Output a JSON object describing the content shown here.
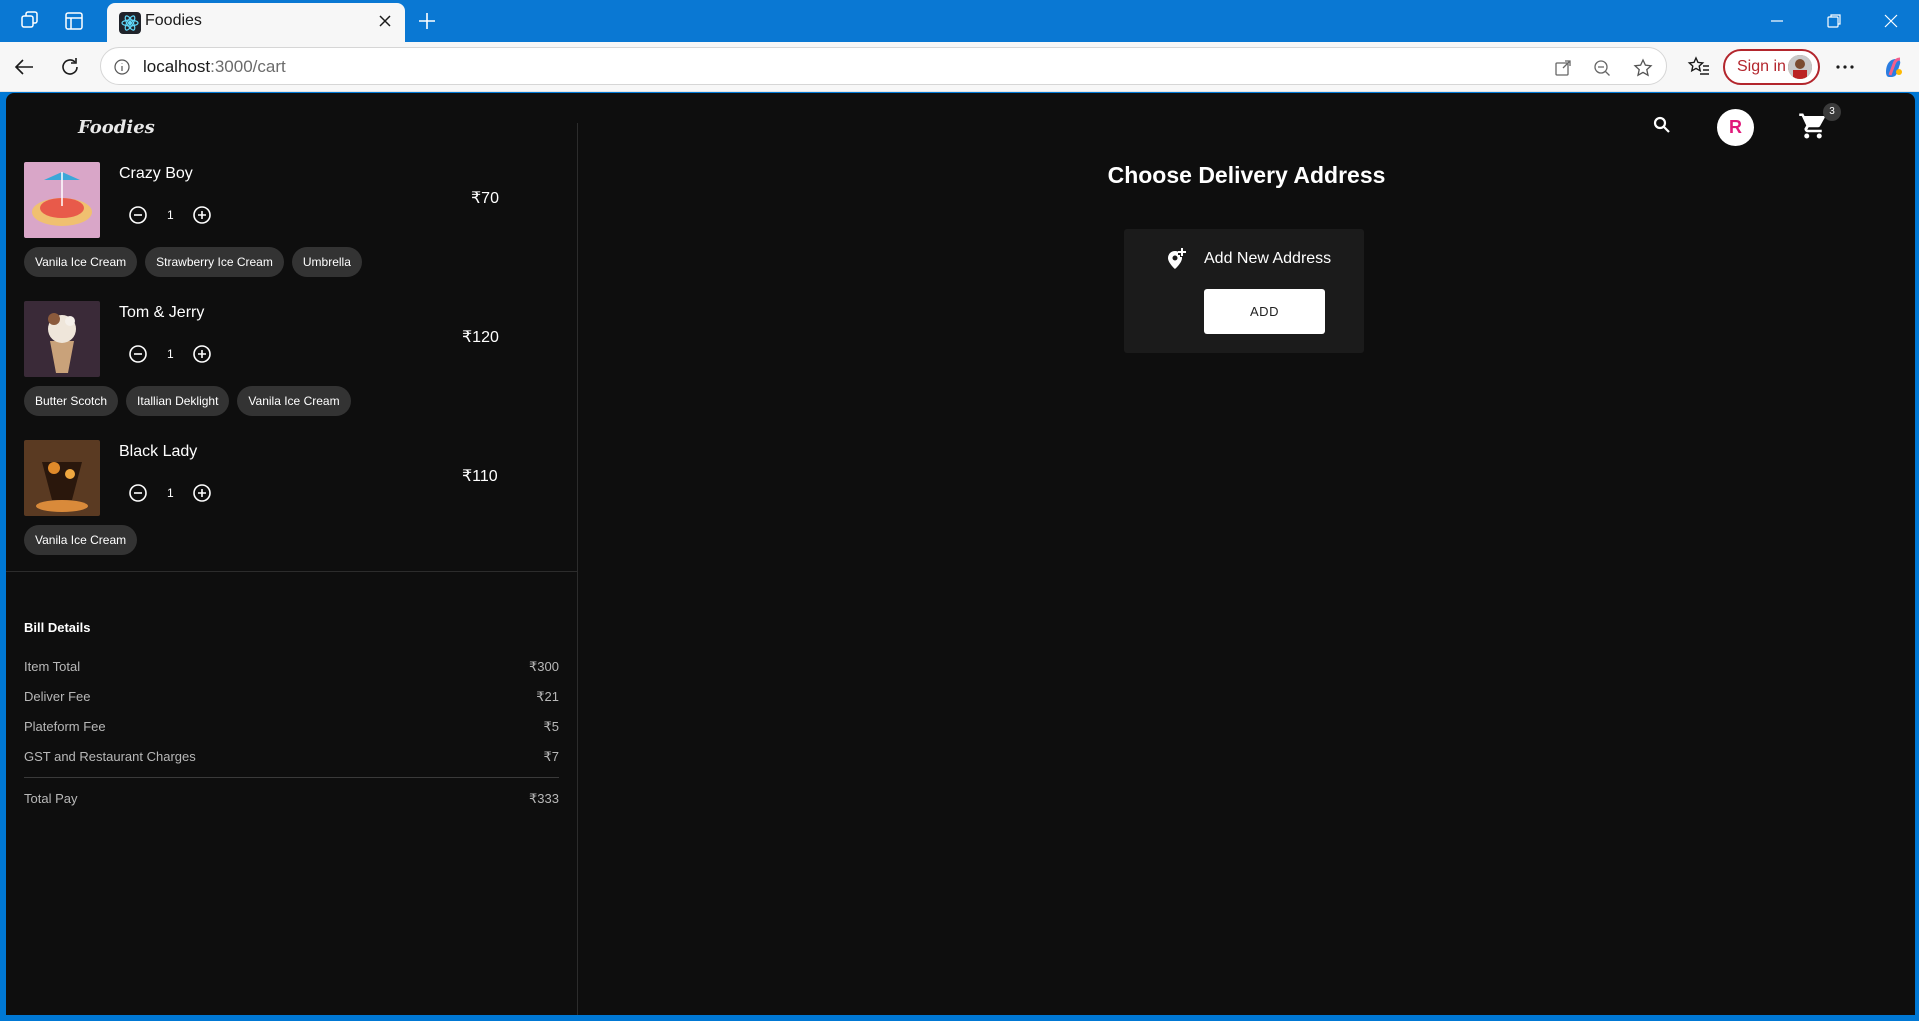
{
  "browser": {
    "tab_title": "Foodies",
    "url_host": "localhost",
    "url_path": ":3000/cart",
    "sign_in_label": "Sign in"
  },
  "header": {
    "brand": "Foodies",
    "avatar_letter": "R",
    "cart_count": "3"
  },
  "cart": {
    "items": [
      {
        "name": "Crazy Boy",
        "qty": "1",
        "price": "₹70",
        "addons": [
          "Vanila Ice Cream",
          "Strawberry Ice Cream",
          "Umbrella"
        ]
      },
      {
        "name": "Tom & Jerry",
        "qty": "1",
        "price": "₹120",
        "addons": [
          "Butter Scotch",
          "Itallian Deklight",
          "Vanila Ice Cream"
        ]
      },
      {
        "name": "Black Lady",
        "qty": "1",
        "price": "₹110",
        "addons": [
          "Vanila Ice Cream"
        ]
      }
    ]
  },
  "bill": {
    "title": "Bill Details",
    "rows": [
      {
        "label": "Item Total",
        "value": "₹300"
      },
      {
        "label": "Deliver Fee",
        "value": "₹21"
      },
      {
        "label": "Plateform Fee",
        "value": "₹5"
      },
      {
        "label": "GST and Restaurant Charges",
        "value": "₹7"
      }
    ],
    "total_label": "Total Pay",
    "total_value": "₹333"
  },
  "address": {
    "title": "Choose Delivery Address",
    "add_new_label": "Add New Address",
    "add_button": "ADD"
  },
  "colors": {
    "browser_blue": "#0a78d3",
    "page_bg": "#0e0e0e",
    "chip_bg": "#333333",
    "avatar_letter": "#e0197a",
    "sign_in_red": "#b3262d"
  }
}
